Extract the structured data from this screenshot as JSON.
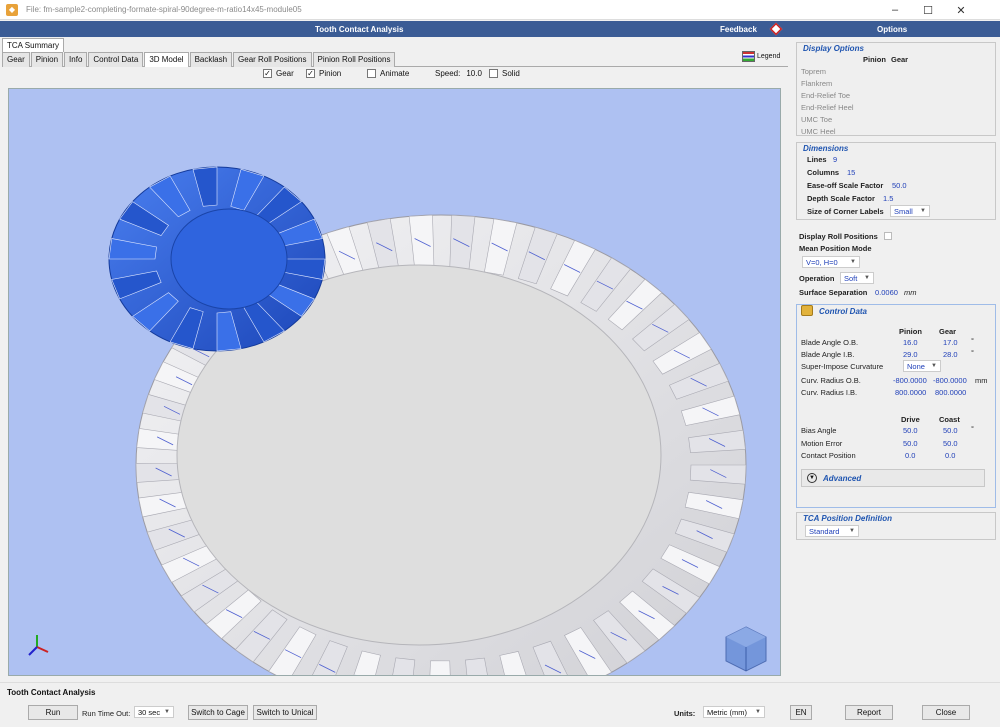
{
  "window": {
    "title": "File: fm-sample2-completing-formate-spiral-90degree-m-ratio14x45-module05",
    "minimize": "–",
    "maximize": "☐",
    "close": "✕"
  },
  "appbar": {
    "title": "Tooth Contact Analysis",
    "feedback": "Feedback",
    "options": "Options"
  },
  "tabs": {
    "top": "TCA Summary",
    "row": [
      "Gear",
      "Pinion",
      "Info",
      "Control Data",
      "3D Model",
      "Backlash",
      "Gear Roll Positions",
      "Pinion Roll Positions"
    ],
    "active": "3D Model"
  },
  "legend_label": "Legend",
  "viewer_controls": {
    "gear_label": "Gear",
    "gear_checked": true,
    "pinion_label": "Pinion",
    "pinion_checked": true,
    "animate_label": "Animate",
    "animate_checked": false,
    "speed_label": "Speed:",
    "speed_value": "10.0",
    "solid_label": "Solid",
    "solid_checked": false
  },
  "viewport": {
    "background": "#aec1f2",
    "pinion_color": "#2a5fd6",
    "gear_color": "#e9e9ec"
  },
  "display_options": {
    "title": "Display Options",
    "col_pinion": "Pinion",
    "col_gear": "Gear",
    "rows": [
      "Toprem",
      "Flankrem",
      "End-Relief Toe",
      "End-Relief Heel",
      "UMC Toe",
      "UMC Heel"
    ]
  },
  "dimensions": {
    "title": "Dimensions",
    "lines_label": "Lines",
    "lines_value": "9",
    "columns_label": "Columns",
    "columns_value": "15",
    "ease_label": "Ease-off Scale Factor",
    "ease_value": "50.0",
    "depth_label": "Depth Scale Factor",
    "depth_value": "1.5",
    "corner_label": "Size of Corner Labels",
    "corner_value": "Small"
  },
  "roll": {
    "display_label": "Display Roll Positions",
    "mean_label": "Mean Position Mode",
    "mean_value": "V=0, H=0",
    "operation_label": "Operation",
    "operation_value": "Soft",
    "separation_label": "Surface Separation",
    "separation_value": "0.0060",
    "separation_unit": "mm"
  },
  "control_data": {
    "title": "Control Data",
    "col_pinion": "Pinion",
    "col_gear": "Gear",
    "blade_ob_label": "Blade Angle O.B.",
    "blade_ob_pinion": "16.0",
    "blade_ob_gear": "17.0",
    "blade_ib_label": "Blade Angle I.B.",
    "blade_ib_pinion": "29.0",
    "blade_ib_gear": "28.0",
    "deg": "°",
    "superimpose_label": "Super-Impose Curvature",
    "superimpose_value": "None",
    "curv_ob_label": "Curv. Radius O.B.",
    "curv_ob_pinion": "-800.0000",
    "curv_ob_gear": "-800.0000",
    "curv_unit": "mm",
    "curv_ib_label": "Curv. Radius I.B.",
    "curv_ib_pinion": "800.0000",
    "curv_ib_gear": "800.0000",
    "col_drive": "Drive",
    "col_coast": "Coast",
    "bias_label": "Bias Angle",
    "bias_drive": "50.0",
    "bias_coast": "50.0",
    "motion_label": "Motion Error",
    "motion_drive": "50.0",
    "motion_coast": "50.0",
    "contact_label": "Contact Position",
    "contact_drive": "0.0",
    "contact_coast": "0.0",
    "advanced_label": "Advanced"
  },
  "tca_position": {
    "title": "TCA Position Definition",
    "value": "Standard"
  },
  "bottom": {
    "heading": "Tooth Contact Analysis",
    "run_label": "Run",
    "timeout_label": "Run Time Out:",
    "timeout_value": "30 sec",
    "cage_label": "Switch to Cage",
    "unical_label": "Switch to Unical",
    "units_label": "Units:",
    "units_value": "Metric (mm)",
    "lang_label": "EN",
    "report_label": "Report",
    "close_label": "Close"
  }
}
